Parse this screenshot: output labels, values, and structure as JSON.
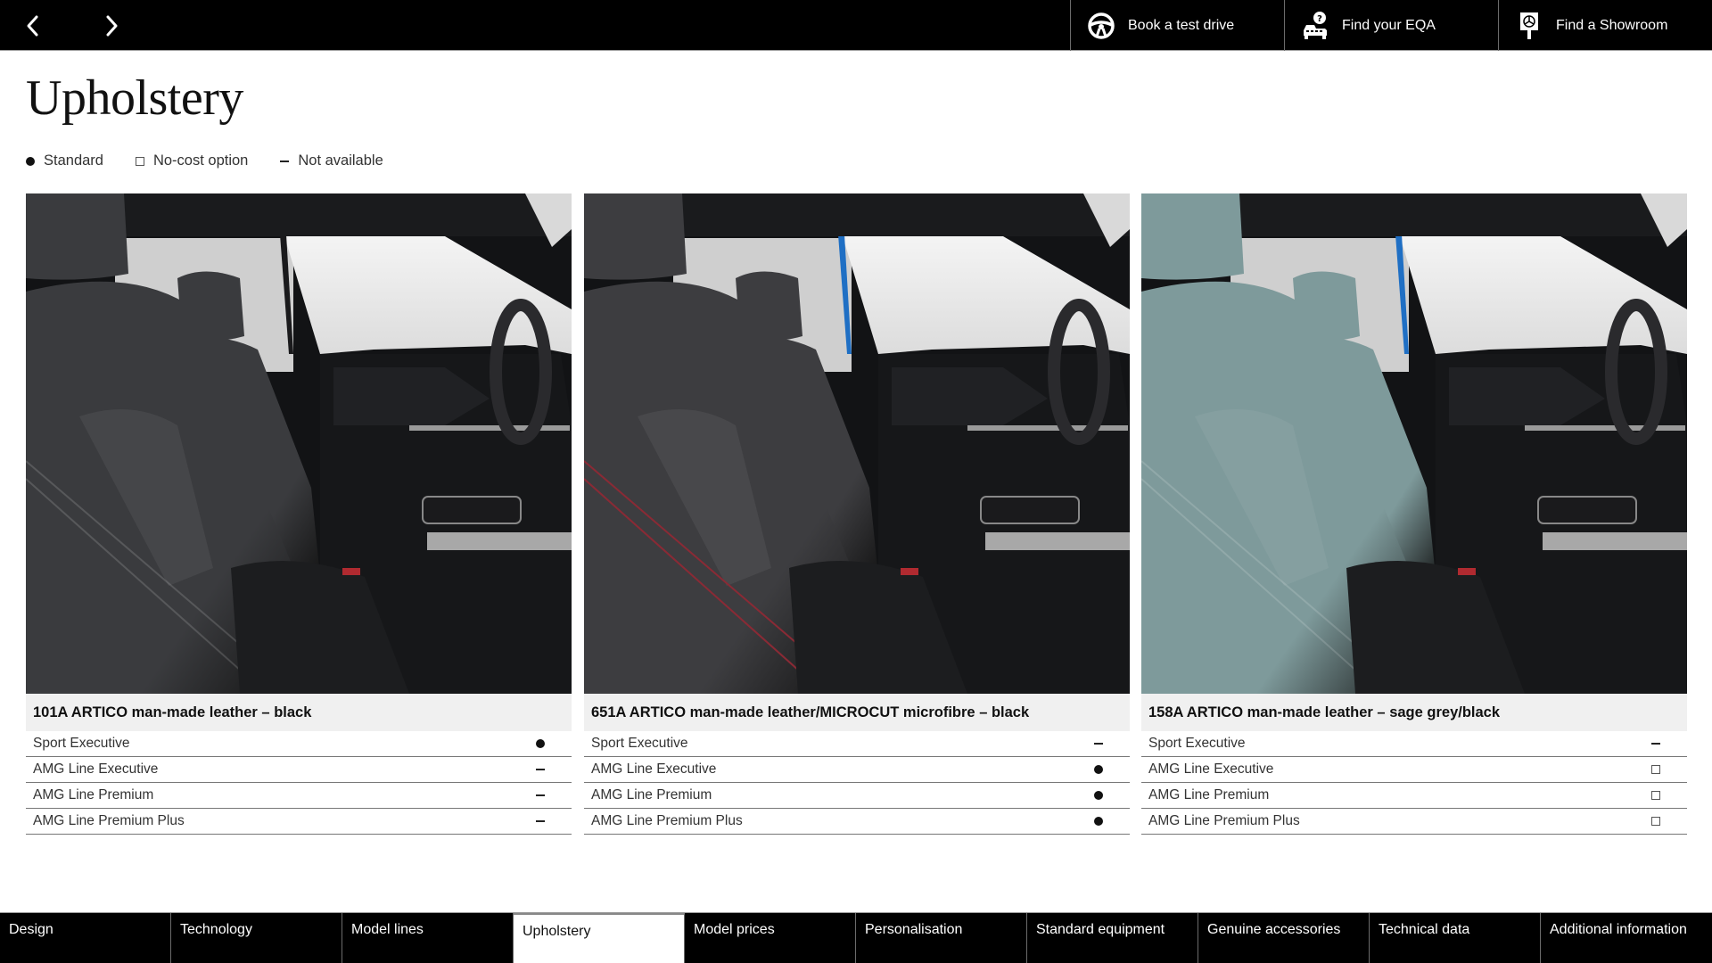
{
  "topbar": {
    "prev_icon": "chevron-left-icon",
    "next_icon": "chevron-right-icon",
    "actions": [
      {
        "label": "Book a test drive",
        "icon": "steering-wheel-icon"
      },
      {
        "label": "Find your EQA",
        "icon": "car-question-icon"
      },
      {
        "label": "Find a Showroom",
        "icon": "showroom-sign-icon"
      }
    ]
  },
  "page": {
    "title": "Upholstery"
  },
  "legend": [
    {
      "symbol": "dot",
      "label": "Standard"
    },
    {
      "symbol": "box",
      "label": "No-cost option"
    },
    {
      "symbol": "dash",
      "label": "Not available"
    }
  ],
  "upholstery": [
    {
      "title": "101A  ARTICO man-made leather – black",
      "seat_color": "#3a3b3e",
      "rows": [
        {
          "label": "Sport Executive",
          "value": "dot"
        },
        {
          "label": "AMG Line Executive",
          "value": "dash"
        },
        {
          "label": "AMG Line Premium",
          "value": "dash"
        },
        {
          "label": "AMG Line Premium Plus",
          "value": "dash"
        }
      ]
    },
    {
      "title": "651A  ARTICO man-made leather/MICROCUT microfibre – black",
      "seat_color": "#3d3d40",
      "stitch_color": "#8a2a35",
      "rows": [
        {
          "label": "Sport Executive",
          "value": "dash"
        },
        {
          "label": "AMG Line Executive",
          "value": "dot"
        },
        {
          "label": "AMG Line Premium",
          "value": "dot"
        },
        {
          "label": "AMG Line Premium Plus",
          "value": "dot"
        }
      ]
    },
    {
      "title": "158A  ARTICO man-made leather – sage grey/black",
      "seat_color": "#7e9a9b",
      "rows": [
        {
          "label": "Sport Executive",
          "value": "dash"
        },
        {
          "label": "AMG Line Executive",
          "value": "box"
        },
        {
          "label": "AMG Line Premium",
          "value": "box"
        },
        {
          "label": "AMG Line Premium Plus",
          "value": "box"
        }
      ]
    }
  ],
  "bottom_tabs": [
    {
      "label": "Design",
      "active": false
    },
    {
      "label": "Technology",
      "active": false
    },
    {
      "label": "Model lines",
      "active": false
    },
    {
      "label": "Upholstery",
      "active": true
    },
    {
      "label": "Model prices",
      "active": false
    },
    {
      "label": "Personalisation",
      "active": false
    },
    {
      "label": "Standard equipment",
      "active": false
    },
    {
      "label": "Genuine accessories",
      "active": false
    },
    {
      "label": "Technical data",
      "active": false
    },
    {
      "label": "Additional information",
      "active": false
    }
  ]
}
